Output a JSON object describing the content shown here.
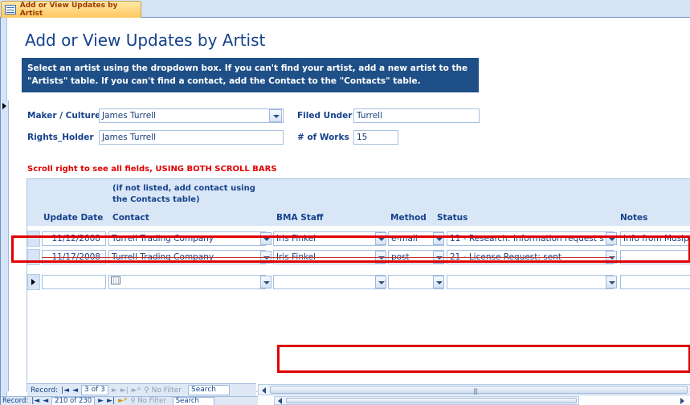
{
  "tab": {
    "label": "Add or View Updates by Artist",
    "icon": "form-icon"
  },
  "title": "Add or View Updates by Artist",
  "instructions": {
    "line1": "Select an artist using the dropdown box. If you can't find your artist, add a new artist to the",
    "line2": "\"Artists\" table. If you can't find a contact, add the Contact to the \"Contacts\" table."
  },
  "fields": {
    "maker_label": "Maker / Culture",
    "maker_value": "James Turrell",
    "filed_label": "Filed Under",
    "filed_value": "Turrell",
    "rights_label": "Rights_Holder",
    "rights_value": "James Turrell",
    "works_label": "# of Works",
    "works_value": "15"
  },
  "warning": "Scroll right to see all fields, USING BOTH SCROLL BARS",
  "subform": {
    "contact_note_line1": "(if not listed, add contact using",
    "contact_note_line2": "the Contacts table)",
    "columns": [
      "Update Date",
      "Contact",
      "BMA Staff",
      "Method",
      "Status",
      "Notes"
    ],
    "rows": [
      {
        "date": "11/12/2008",
        "contact": "Turrell Trading Company",
        "staff": "Iris Finkel",
        "method": "e-mail",
        "status": "11 - Research: Information request s",
        "notes": "Info from Musip"
      },
      {
        "date": "11/17/2008",
        "contact": "Turrell Trading Company",
        "staff": "Iris Finkel",
        "method": "post",
        "status": "21 - License Request: sent",
        "notes": ""
      }
    ]
  },
  "subnav": {
    "prefix": "Record:",
    "position": "3 of 3",
    "filter": "No Filter",
    "search": "Search"
  },
  "mainnav": {
    "prefix": "Record:",
    "position": "210 of 230",
    "filter": "No Filter",
    "search": "Search"
  },
  "colors": {
    "accent": "#15428b",
    "banner": "#1f4f87",
    "warning": "#e00000",
    "tab": "#ffc75f"
  }
}
